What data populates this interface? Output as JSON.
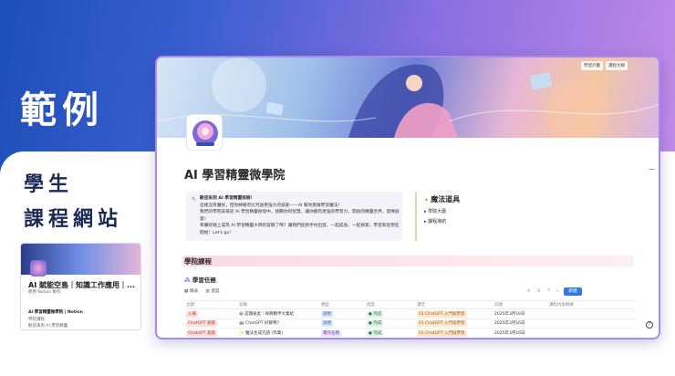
{
  "left": {
    "title": "範例",
    "subtitle_line1": "學生",
    "subtitle_line2": "課程網站"
  },
  "thumbnail": {
    "title": "AI 賦能空島｜知識工作應用｜...",
    "meta": "使用 Notion 製作",
    "section": "AI 學習精靈微學院 | Notion",
    "line1": "學院課程",
    "line2": "歡迎來到 AI 學習精靈"
  },
  "notion": {
    "banner_buttons": [
      "學習計畫",
      "課程大綱"
    ],
    "page_title": "AI 學習精靈微學院",
    "callout": {
      "icon": "pen-icon",
      "line1": "歡迎來到 AI 學習精靈探險！",
      "line2": "這裡沒有魔杖，但你將擁有比咒語更強大的技能——AI 幫你施展學習魔法！",
      "line3": "我們的學院安排從 AI 學習精靈秘境中，挑戰你的智慧，讓你擁有更強的學習力，開啟的精靈世界，發揮創意！",
      "line4": "準備好踏上成為 AI 學習精靈大師的冒險了嗎？讓我們從新手村出發，一起成長、一起探索，學習就從現在開始！Let's go!"
    },
    "tools": {
      "title": "魔法道具",
      "items": [
        "學院大廳",
        "課程導航"
      ]
    },
    "section_title": "學院課程",
    "database": {
      "title": "學習任務",
      "tabs": [
        "總表",
        "進度"
      ],
      "toolbar_icons": [
        "filter-icon",
        "sort-icon",
        "lightning-icon",
        "search-icon",
        "expand-icon",
        "more-icon"
      ],
      "new_button": "新建",
      "columns": [
        "主題",
        "名稱",
        "類型",
        "進度",
        "課堂",
        "日期",
        "課程內容摘要"
      ],
      "rows": [
        {
          "topic": "入場",
          "topic_color": "red",
          "name": "認識彼此｜探險夥伴大集結",
          "type": "說明",
          "status": "完成",
          "class": "01 ChatGPT 入門與學習",
          "date": "2025年3月16日"
        },
        {
          "topic": "ChatGPT 基礎",
          "topic_color": "red",
          "name": "ChatGPT 好聊嗎?",
          "type": "說明",
          "status": "完成",
          "class": "01 ChatGPT 入門與學習",
          "date": "2025年3月16日"
        },
        {
          "topic": "ChatGPT 基礎",
          "topic_color": "red",
          "name": "魔法生成咒語 (作業)",
          "type": "實作任務",
          "status": "完成",
          "class": "01 ChatGPT 入門與學習",
          "date": "2025年3月16日"
        }
      ]
    }
  }
}
